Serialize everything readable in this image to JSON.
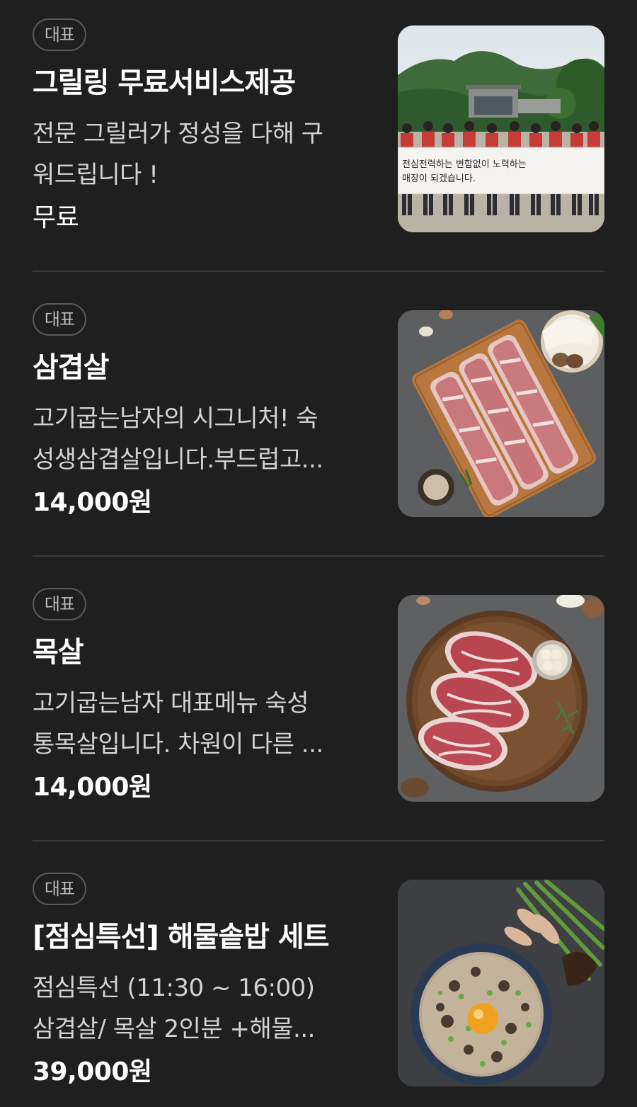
{
  "menu": {
    "items": [
      {
        "badge": "대표",
        "title": "그릴링 무료서비스제공",
        "desc_line1": "전문 그릴러가 정성을 다해 구",
        "desc_line2": "워드립니다 !",
        "price": "무료",
        "image": "group-photo-banner"
      },
      {
        "badge": "대표",
        "title": "삼겹살",
        "desc_line1": "고기굽는남자의 시그니처! 숙",
        "desc_line2": "성생삼겹살입니다.부드럽고...",
        "price": "14,000원",
        "image": "pork-belly-on-board"
      },
      {
        "badge": "대표",
        "title": "목살",
        "desc_line1": "고기굽는남자 대표메뉴 숙성",
        "desc_line2": "통목살입니다. 차원이 다른 ...",
        "price": "14,000원",
        "image": "pork-neck-on-board"
      },
      {
        "badge": "대표",
        "title": "[점심특선] 해물솥밥 세트",
        "desc_line1": "점심특선 (11:30 ~ 16:00)",
        "desc_line2": "삼겹살/ 목살 2인분 +해물...",
        "price": "39,000원",
        "image": "seafood-pot-rice"
      }
    ]
  },
  "photo_texts": {
    "banner_line1": "전심전력하는 변함없이 노력하는",
    "banner_line2": "매장이 되겠습니다."
  },
  "colors": {
    "background": "#1f1f20",
    "divider": "#3a3a3b",
    "badge_border": "#5a5a5c",
    "text_primary": "#ffffff",
    "text_secondary": "#d2d2d4"
  }
}
